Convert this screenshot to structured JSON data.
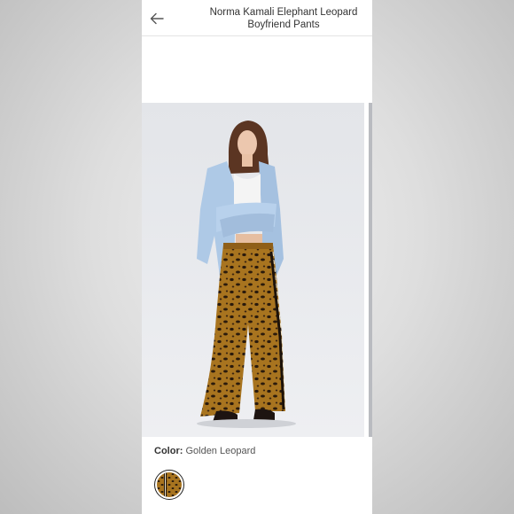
{
  "header": {
    "title_line1": "Norma Kamali Elephant Leopard",
    "title_line2": "Boyfriend Pants",
    "back_icon": "arrow-left-icon"
  },
  "product": {
    "color_label": "Color:",
    "color_value": "Golden Leopard",
    "colors": {
      "leopard_base": "#a8741f",
      "leopard_spot": "#2a1a0c",
      "shirt": "#aec9e6",
      "backdrop": "#e9ebef"
    }
  }
}
